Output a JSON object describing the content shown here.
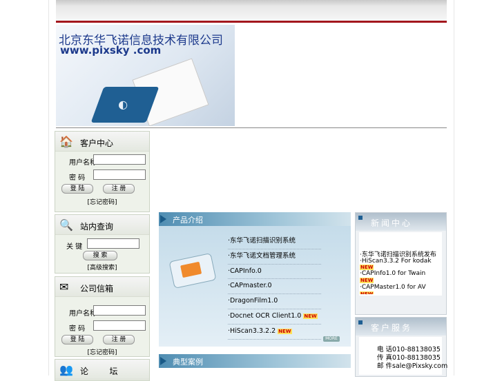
{
  "banner": {
    "company": "北京东华飞诺信息技术有限公司",
    "url": "www.pixsky .com"
  },
  "customer": {
    "title": "客户中心",
    "username_label": "用户名称",
    "password_label": "密 码",
    "login_button": "登 陆",
    "register_button": "注 册",
    "forgot_link": "[忘记密码]"
  },
  "search": {
    "title": "站内查询",
    "keyword_label": "关 键",
    "search_button": "搜 索",
    "advanced_link": "[高级搜索]"
  },
  "mail": {
    "title": "公司信箱",
    "username_label": "用户名称",
    "password_label": "密 码",
    "login_button": "登 陆",
    "register_button": "注 册",
    "forgot_link": "[忘记密码]"
  },
  "forum": {
    "title": "论        坛"
  },
  "products": {
    "title": "产品介绍",
    "items": [
      {
        "label": "·东华飞诺扫描识别系统",
        "new": false
      },
      {
        "label": "·东华飞诺文档管理系统",
        "new": false
      },
      {
        "label": "·CAPInfo.0",
        "new": false
      },
      {
        "label": "·CAPmaster.0",
        "new": false
      },
      {
        "label": "·DragonFilm1.0",
        "new": false
      },
      {
        "label": "·Docnet OCR Client1.0 ",
        "new": true
      },
      {
        "label": "·HiScan3.3.2.2 ",
        "new": true
      }
    ],
    "more": "MORE"
  },
  "cases": {
    "title": "典型案例"
  },
  "news": {
    "title": "新闻中心",
    "items": [
      {
        "label": "·东华飞诺扫描识别系统发布",
        "new": false
      },
      {
        "label": "·HiScan3.3.2 For kodak",
        "new": true
      },
      {
        "label": "·CAPInfo1.0 for Twain",
        "new": true
      },
      {
        "label": "·CAPMaster1.0 for AV",
        "new": true
      }
    ],
    "new_badge": "NEW"
  },
  "service": {
    "title": "客户服务",
    "lines": [
      "电 话010-88138035",
      "传 真010-88138035",
      "邮 件sale@Pixsky.com"
    ]
  }
}
